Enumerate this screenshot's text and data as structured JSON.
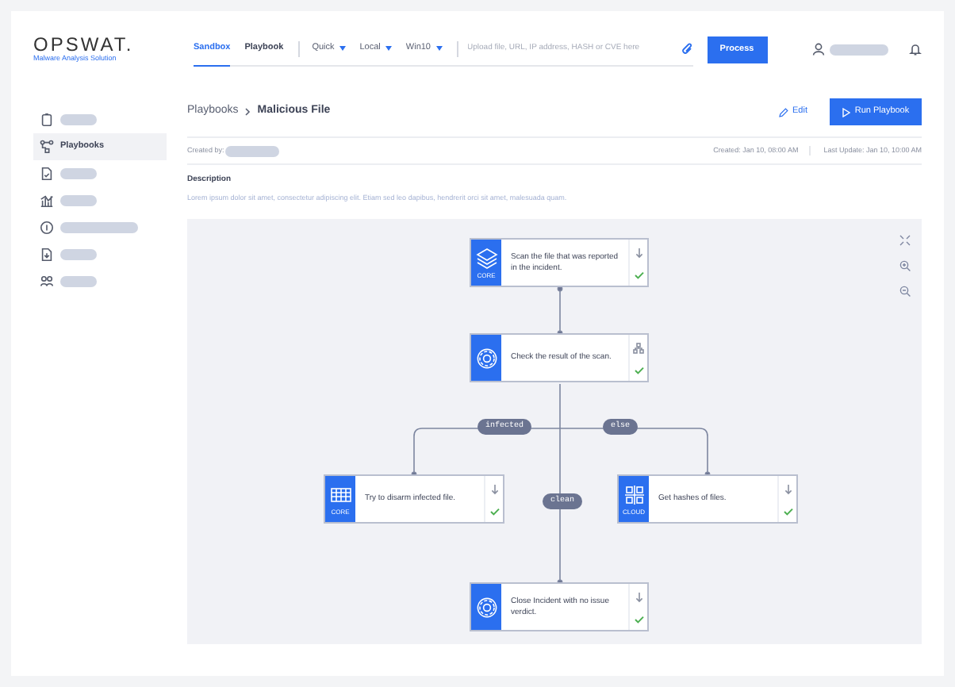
{
  "header": {
    "logo": "OPSWAT.",
    "subtitle": "Malware Analysis Solution",
    "tabs": [
      {
        "label": "Sandbox",
        "selected": true
      },
      {
        "label": "Playbook",
        "selected": false
      }
    ],
    "dropdowns": [
      "Quick",
      "Local",
      "Win10"
    ],
    "search": {
      "placeholder": "Upload file, URL, IP address, HASH or CVE here"
    },
    "process_button": "Process"
  },
  "sidebar": {
    "items": [
      {
        "kind": "clipboard",
        "selected": false
      },
      {
        "kind": "flow",
        "label": "Playbooks",
        "selected": true
      },
      {
        "kind": "document",
        "selected": false
      },
      {
        "kind": "chart",
        "selected": false
      },
      {
        "kind": "info",
        "selected": false
      },
      {
        "kind": "file",
        "selected": false
      },
      {
        "kind": "people",
        "selected": false
      }
    ]
  },
  "breadcrumb": [
    "Playbooks",
    "Malicious File"
  ],
  "edit_button": "Edit",
  "run_button": "Run Playbook",
  "meta": {
    "created_by": "Created by:",
    "created": "Created: Jan 10, 08:00 AM",
    "updated": "Last Update: Jan 10, 10:00 AM"
  },
  "description": {
    "title": "Description",
    "text": "Lorem ipsum dolor sit amet, consectetur adipiscing elit. Etiam sed leo dapibus, hendrerit orci sit amet, malesuada quam."
  },
  "flow": {
    "nodes": [
      {
        "kind": "core",
        "tag": "CORE",
        "text": "Scan the file that was reported in the incident.",
        "action": {
          "kind": "download"
        }
      },
      {
        "kind": "gear",
        "text": "Check the result of the scan.",
        "action": {
          "kind": "branch"
        }
      },
      {
        "kind": "grid",
        "tag": "CORE",
        "text": "Try to disarm infected file.",
        "action": {
          "kind": "download"
        }
      },
      {
        "kind": "hash",
        "tag": "CLOUD",
        "text": "Get hashes of files.",
        "action": {
          "kind": "download"
        }
      },
      {
        "kind": "gear",
        "text": "Close Incident with no issue verdict.",
        "action": {
          "kind": "download"
        }
      }
    ],
    "branches": [
      "infected",
      "else",
      "clean"
    ]
  }
}
